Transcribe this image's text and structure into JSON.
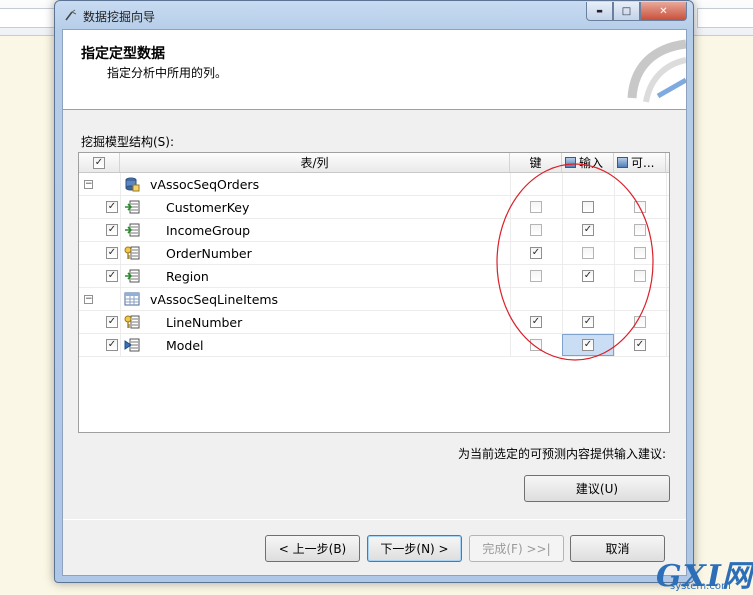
{
  "window": {
    "title": "数据挖掘向导",
    "controls": {
      "minimize": "▬",
      "maximize": "□",
      "close": "✕"
    }
  },
  "header": {
    "title": "指定定型数据",
    "subtitle": "指定分析中所用的列。"
  },
  "grid": {
    "label": "挖掘模型结构(S):",
    "columns": {
      "table_column": "表/列",
      "key": "键",
      "input": "输入",
      "predictable": "可..."
    },
    "rows": [
      {
        "type": "table",
        "name": "vAssocSeqOrders",
        "icon": "case-table-icon",
        "expanded": true
      },
      {
        "type": "column",
        "name": "CustomerKey",
        "icon": "column-icon",
        "included": true,
        "key": false,
        "input": false,
        "predict": false
      },
      {
        "type": "column",
        "name": "IncomeGroup",
        "icon": "column-icon",
        "included": true,
        "key": false,
        "input": true,
        "predict": false
      },
      {
        "type": "column",
        "name": "OrderNumber",
        "icon": "key-column-icon",
        "included": true,
        "key": true,
        "input": false,
        "predict": false
      },
      {
        "type": "column",
        "name": "Region",
        "icon": "column-icon",
        "included": true,
        "key": false,
        "input": true,
        "predict": false
      },
      {
        "type": "table",
        "name": "vAssocSeqLineItems",
        "icon": "nested-table-icon",
        "expanded": true
      },
      {
        "type": "column",
        "name": "LineNumber",
        "icon": "key-column-icon",
        "included": true,
        "key": true,
        "input": true,
        "predict": false
      },
      {
        "type": "column",
        "name": "Model",
        "icon": "predict-column-icon",
        "included": true,
        "key": false,
        "input": true,
        "predict": true
      }
    ]
  },
  "suggest": {
    "hint": "为当前选定的可预测内容提供输入建议:",
    "button": "建议(U)"
  },
  "footer": {
    "back": "< 上一步(B)",
    "next": "下一步(N) >",
    "finish": "完成(F) >>|",
    "cancel": "取消"
  },
  "watermark": {
    "main": "GXI网",
    "sub": "system.com"
  },
  "colors": {
    "annotation": "#d9202a",
    "selection": "#c9def5",
    "titlebar": "#b6cde9"
  }
}
